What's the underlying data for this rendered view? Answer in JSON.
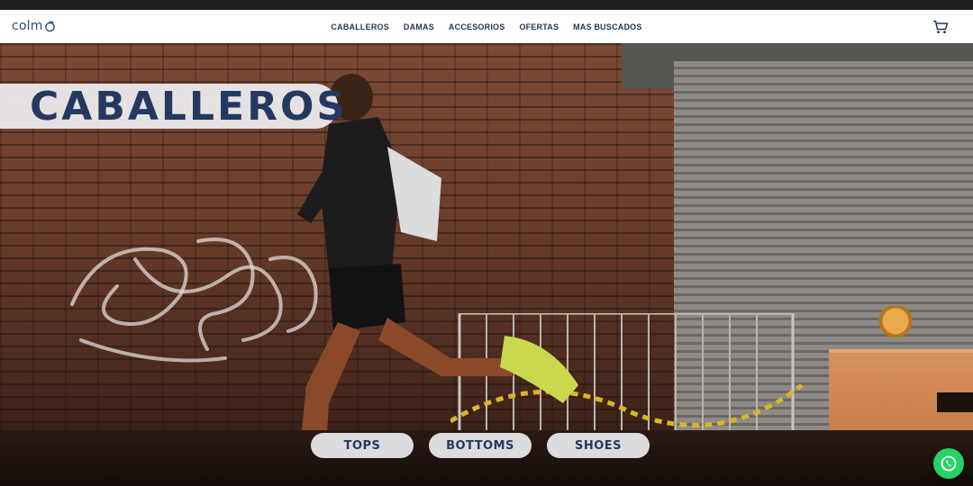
{
  "brand": {
    "logo_text": "colm",
    "accent": "#2c4a7a"
  },
  "nav": {
    "items": [
      {
        "label": "CABALLEROS"
      },
      {
        "label": "DAMAS"
      },
      {
        "label": "ACCESORIOS"
      },
      {
        "label": "OFERTAS"
      },
      {
        "label": "MAS BUSCADOS"
      }
    ],
    "cart_icon": "cart-icon"
  },
  "hero": {
    "title": "CABALLEROS",
    "categories": [
      {
        "label": "TOPS"
      },
      {
        "label": "BOTTOMS"
      },
      {
        "label": "SHOES"
      }
    ]
  },
  "whatsapp": {
    "icon": "whatsapp-icon",
    "color": "#25d366"
  }
}
